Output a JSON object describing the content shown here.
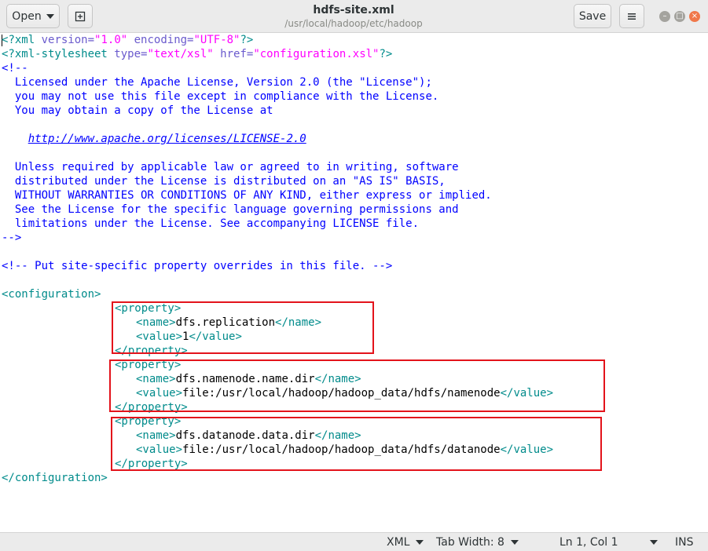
{
  "header": {
    "open_label": "Open",
    "new_tab_icon": "new-document-icon",
    "title": "hdfs-site.xml",
    "subtitle": "/usr/local/hadoop/etc/hadoop",
    "save_label": "Save",
    "menu_icon": "hamburger-icon",
    "minimize_icon": "minimize-icon",
    "maximize_icon": "maximize-icon",
    "close_icon": "close-icon"
  },
  "code": {
    "l1": [
      "?xml ",
      "version=",
      "\"1.0\"",
      " encoding=",
      "\"UTF-8\"",
      "?>"
    ],
    "l2": [
      "<?xml-stylesheet ",
      "type=",
      "\"text/xsl\"",
      " href=",
      "\"configuration.xsl\"",
      "?>"
    ],
    "l3": "<!--",
    "l4": "  Licensed under the Apache License, Version 2.0 (the \"License\");",
    "l5": "  you may not use this file except in compliance with the License.",
    "l6": "  You may obtain a copy of the License at",
    "l8_indent": "    ",
    "l8_link": "http://www.apache.org/licenses/LICENSE-2.0",
    "l10": "  Unless required by applicable law or agreed to in writing, software",
    "l11": "  distributed under the License is distributed on an \"AS IS\" BASIS,",
    "l12": "  WITHOUT WARRANTIES OR CONDITIONS OF ANY KIND, either express or implied.",
    "l13": "  See the License for the specific language governing permissions and",
    "l14": "  limitations under the License. See accompanying LICENSE file.",
    "l15": "-->",
    "l17": "<!-- Put site-specific property overrides in this file. -->",
    "l19": "<configuration>",
    "property_open": "<property>",
    "property_close": "</property>",
    "name_open": "<name>",
    "name_close": "</name>",
    "value_open": "<value>",
    "value_close": "</value>",
    "p1_name": "dfs.replication",
    "p1_value": "1",
    "p2_name": "dfs.namenode.name.dir",
    "p2_value": "file:/usr/local/hadoop/hadoop_data/hdfs/namenode",
    "p3_name": "dfs.datanode.data.dir",
    "p3_value": "file:/usr/local/hadoop/hadoop_data/hdfs/datanode",
    "config_close": "</configuration>"
  },
  "status": {
    "language": "XML",
    "tab_width": "Tab Width: 8",
    "position": "Ln 1, Col 1",
    "mode": "INS"
  },
  "colors": {
    "highlight_box": "#e3131b",
    "tag": "#008b8b",
    "comment": "#0000ff",
    "string": "#ff00ff"
  }
}
